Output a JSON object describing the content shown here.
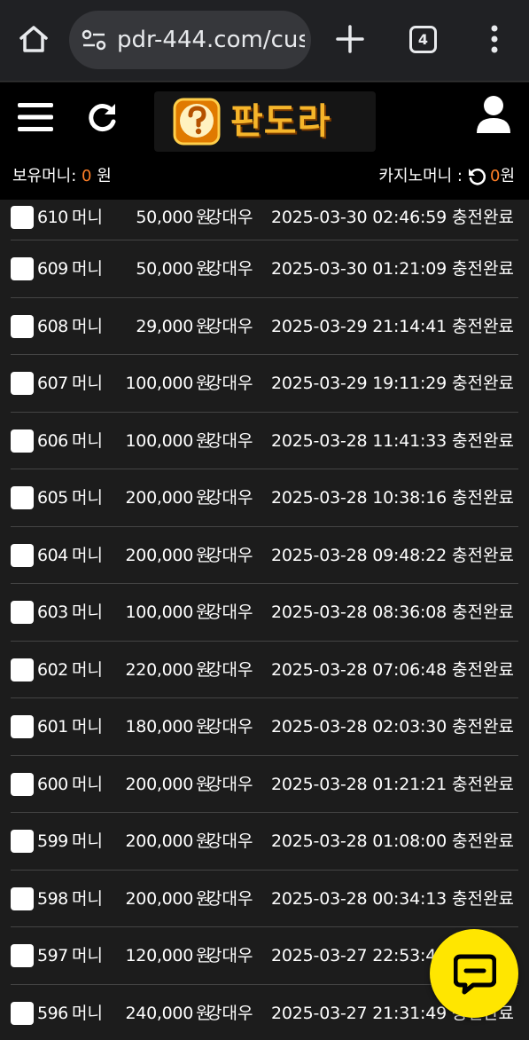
{
  "browser": {
    "url": "pdr-444.com/cus",
    "tab_count": "4"
  },
  "header": {
    "logo_text": "판도라",
    "wallet_label": "보유머니: ",
    "wallet_value": "0",
    "wallet_unit": " 원",
    "casino_label": "카지노머니 :",
    "casino_value": "0",
    "casino_unit": " 원"
  },
  "rows": [
    {
      "no": "610",
      "type": "머니",
      "amount": "50,000",
      "won": "원",
      "name": "강대우",
      "date": "2025-03-30 02:46:59",
      "status": "충전완료"
    },
    {
      "no": "609",
      "type": "머니",
      "amount": "50,000",
      "won": "원",
      "name": "강대우",
      "date": "2025-03-30 01:21:09",
      "status": "충전완료"
    },
    {
      "no": "608",
      "type": "머니",
      "amount": "29,000",
      "won": "원",
      "name": "강대우",
      "date": "2025-03-29 21:14:41",
      "status": "충전완료"
    },
    {
      "no": "607",
      "type": "머니",
      "amount": "100,000",
      "won": "원",
      "name": "강대우",
      "date": "2025-03-29 19:11:29",
      "status": "충전완료"
    },
    {
      "no": "606",
      "type": "머니",
      "amount": "100,000",
      "won": "원",
      "name": "강대우",
      "date": "2025-03-28 11:41:33",
      "status": "충전완료"
    },
    {
      "no": "605",
      "type": "머니",
      "amount": "200,000",
      "won": "원",
      "name": "강대우",
      "date": "2025-03-28 10:38:16",
      "status": "충전완료"
    },
    {
      "no": "604",
      "type": "머니",
      "amount": "200,000",
      "won": "원",
      "name": "강대우",
      "date": "2025-03-28 09:48:22",
      "status": "충전완료"
    },
    {
      "no": "603",
      "type": "머니",
      "amount": "100,000",
      "won": "원",
      "name": "강대우",
      "date": "2025-03-28 08:36:08",
      "status": "충전완료"
    },
    {
      "no": "602",
      "type": "머니",
      "amount": "220,000",
      "won": "원",
      "name": "강대우",
      "date": "2025-03-28 07:06:48",
      "status": "충전완료"
    },
    {
      "no": "601",
      "type": "머니",
      "amount": "180,000",
      "won": "원",
      "name": "강대우",
      "date": "2025-03-28 02:03:30",
      "status": "충전완료"
    },
    {
      "no": "600",
      "type": "머니",
      "amount": "200,000",
      "won": "원",
      "name": "강대우",
      "date": "2025-03-28 01:21:21",
      "status": "충전완료"
    },
    {
      "no": "599",
      "type": "머니",
      "amount": "200,000",
      "won": "원",
      "name": "강대우",
      "date": "2025-03-28 01:08:00",
      "status": "충전완료"
    },
    {
      "no": "598",
      "type": "머니",
      "amount": "200,000",
      "won": "원",
      "name": "강대우",
      "date": "2025-03-28 00:34:13",
      "status": "충전완료"
    },
    {
      "no": "597",
      "type": "머니",
      "amount": "120,000",
      "won": "원",
      "name": "강대우",
      "date": "2025-03-27 22:53:4",
      "status": ""
    },
    {
      "no": "596",
      "type": "머니",
      "amount": "240,000",
      "won": "원",
      "name": "강대우",
      "date": "2025-03-27 21:31:49",
      "status": "충전완료"
    }
  ],
  "icons": {
    "home": "home-icon",
    "site_info": "site-info-icon",
    "new_tab": "plus-icon",
    "menu": "more-vert-icon",
    "hamburger": "hamburger-icon",
    "refresh": "refresh-icon",
    "user": "user-icon",
    "chat": "chat-icon"
  },
  "colors": {
    "accent": "#ff7f27",
    "chat_fab": "#ffe600",
    "logo": "#f6b52a"
  }
}
